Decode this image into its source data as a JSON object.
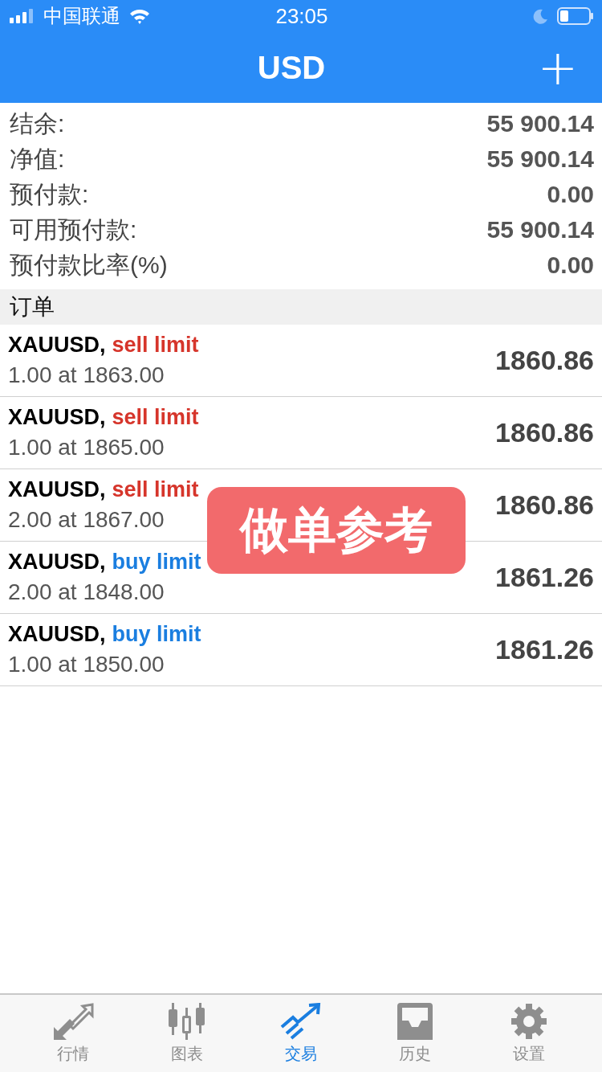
{
  "status_bar": {
    "carrier": "中国联通",
    "time": "23:05"
  },
  "nav": {
    "title": "USD",
    "add_button": "+"
  },
  "summary": [
    {
      "label": "结余:",
      "value": "55 900.14"
    },
    {
      "label": "净值:",
      "value": "55 900.14"
    },
    {
      "label": "预付款:",
      "value": "0.00"
    },
    {
      "label": "可用预付款:",
      "value": "55 900.14"
    },
    {
      "label": "预付款比率(%)",
      "value": "0.00"
    }
  ],
  "orders_header": "订单",
  "orders": [
    {
      "symbol": "XAUUSD,",
      "type": "sell limit",
      "kind": "sell",
      "volume": "1.00 at 1863.00",
      "price": "1860.86"
    },
    {
      "symbol": "XAUUSD,",
      "type": "sell limit",
      "kind": "sell",
      "volume": "1.00 at 1865.00",
      "price": "1860.86"
    },
    {
      "symbol": "XAUUSD,",
      "type": "sell limit",
      "kind": "sell",
      "volume": "2.00 at 1867.00",
      "price": "1860.86"
    },
    {
      "symbol": "XAUUSD,",
      "type": "buy limit",
      "kind": "buy",
      "volume": "2.00 at 1848.00",
      "price": "1861.26"
    },
    {
      "symbol": "XAUUSD,",
      "type": "buy limit",
      "kind": "buy",
      "volume": "1.00 at 1850.00",
      "price": "1861.26"
    }
  ],
  "overlay_label": "做单参考",
  "tabs": [
    {
      "label": "行情",
      "selected": false
    },
    {
      "label": "图表",
      "selected": false
    },
    {
      "label": "交易",
      "selected": true
    },
    {
      "label": "历史",
      "selected": false
    },
    {
      "label": "设置",
      "selected": false
    }
  ]
}
